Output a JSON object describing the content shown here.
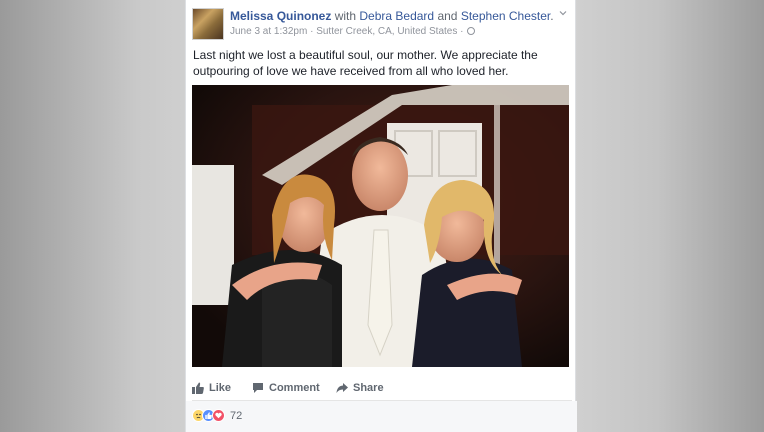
{
  "post": {
    "author": "Melissa Quinonez",
    "with_word": "with",
    "tagged_1": "Debra Bedard",
    "and_word": "and",
    "tagged_2": "Stephen Chester",
    "period": ".",
    "timestamp": "June 3 at 1:32pm",
    "separator": "·",
    "location": "Sutter Creek, CA, United States",
    "separator2": "·",
    "privacy_icon": "globe-icon",
    "text": "Last night we lost a beautiful soul, our mother. We appreciate the outpouring of love we have received from all who loved her."
  },
  "actions": {
    "like": "Like",
    "comment": "Comment",
    "share": "Share"
  },
  "reactions": {
    "icons": [
      "sad-icon",
      "like-icon",
      "love-icon"
    ],
    "count": "72"
  },
  "colors": {
    "link": "#365899",
    "like_blue": "#5890ff",
    "love_red": "#f25268",
    "sad_yellow": "#fcd669"
  }
}
